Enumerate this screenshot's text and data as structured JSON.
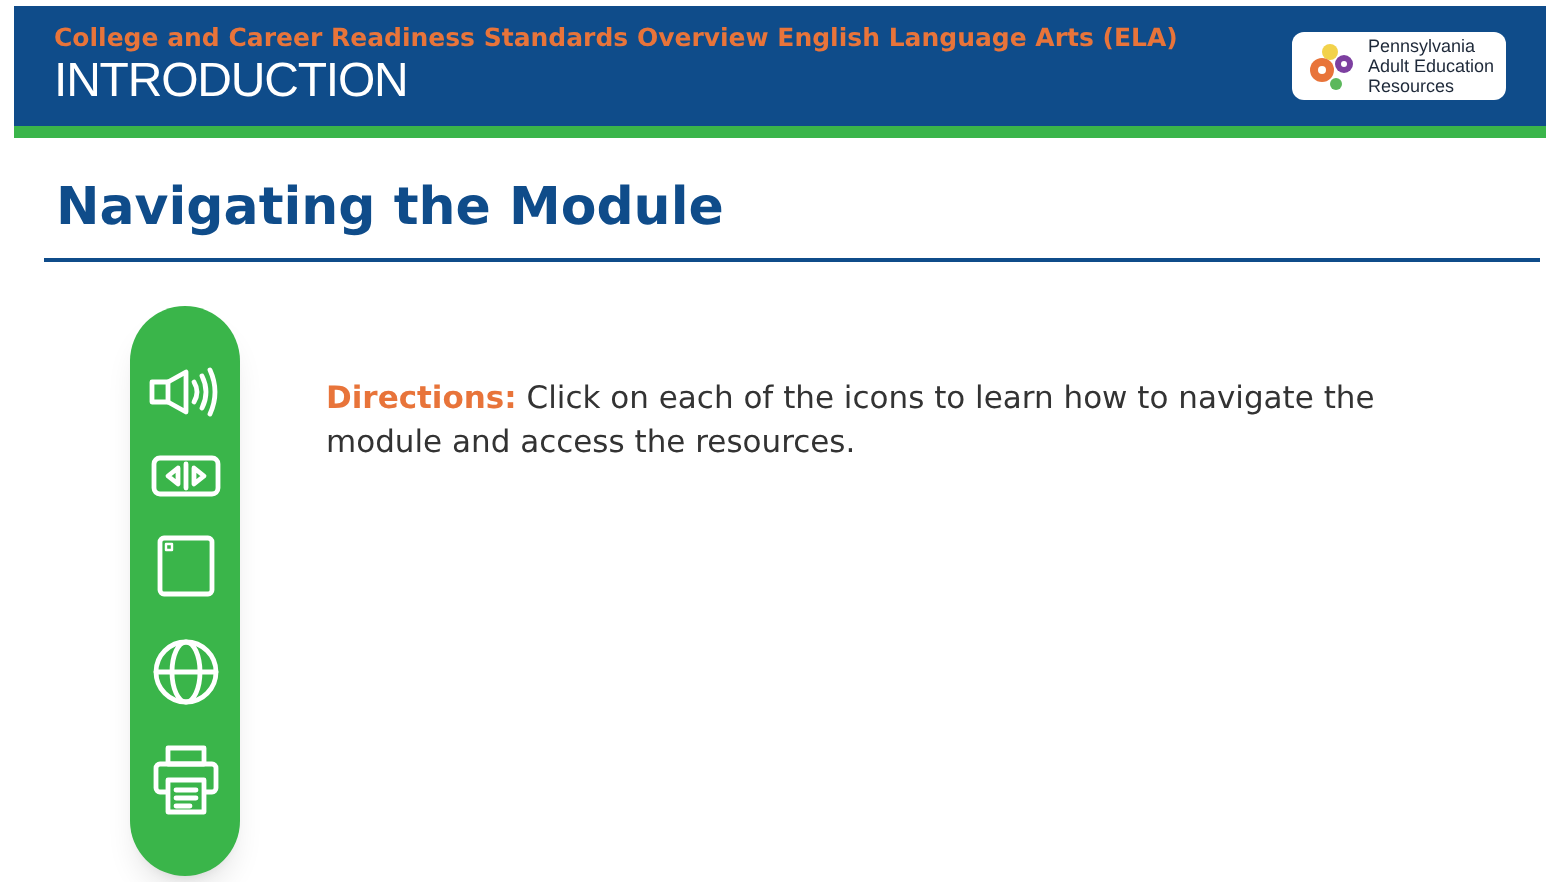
{
  "header": {
    "course_title": "College and Career Readiness Standards Overview English Language Arts (ELA)",
    "section": "INTRODUCTION",
    "logo_lines": [
      "Pennsylvania",
      "Adult Education",
      "Resources"
    ]
  },
  "page_title": "Navigating the Module",
  "toolbar": [
    {
      "kind": "audio"
    },
    {
      "kind": "navigation"
    },
    {
      "kind": "window"
    },
    {
      "kind": "web"
    },
    {
      "kind": "print"
    }
  ],
  "directions": {
    "label": "Directions:",
    "text": "Click on each of the icons to learn how to navigate the module and access the resources."
  }
}
